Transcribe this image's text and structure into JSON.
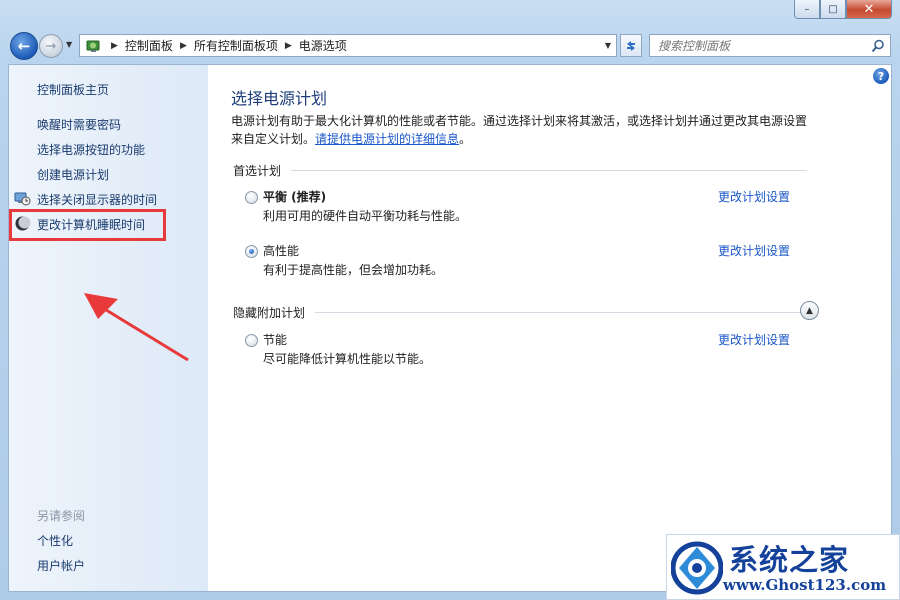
{
  "window": {
    "min_glyph": "–",
    "max_glyph": "□",
    "close_glyph": "✕"
  },
  "navbar": {
    "breadcrumbs": [
      "控制面板",
      "所有控制面板项",
      "电源选项"
    ],
    "search_placeholder": "搜索控制面板"
  },
  "sidebar": {
    "home": "控制面板主页",
    "items": [
      {
        "label": "唤醒时需要密码",
        "icon": ""
      },
      {
        "label": "选择电源按钮的功能",
        "icon": ""
      },
      {
        "label": "创建电源计划",
        "icon": ""
      },
      {
        "label": "选择关闭显示器的时间",
        "icon": "monitor-clock-icon"
      },
      {
        "label": "更改计算机睡眠时间",
        "icon": "moon-icon"
      }
    ],
    "see_also_title": "另请参阅",
    "see_also": [
      "个性化",
      "用户帐户"
    ]
  },
  "main": {
    "title": "选择电源计划",
    "description": "电源计划有助于最大化计算机的性能或者节能。通过选择计划来将其激活，或选择计划并通过更改其电源设置来自定义计划。",
    "details_link": "请提供电源计划的详细信息",
    "preferred_heading": "首选计划",
    "hidden_heading": "隐藏附加计划",
    "plans": [
      {
        "name": "平衡 (推荐)",
        "desc": "利用可用的硬件自动平衡功耗与性能。",
        "selected": false,
        "link": "更改计划设置"
      },
      {
        "name": "高性能",
        "desc": "有利于提高性能，但会增加功耗。",
        "selected": true,
        "link": "更改计划设置"
      },
      {
        "name": "节能",
        "desc": "尽可能降低计算机性能以节能。",
        "selected": false,
        "link": "更改计划设置"
      }
    ],
    "help_glyph": "?"
  },
  "annotation": {
    "highlight_color": "#e83a3a"
  },
  "watermark": {
    "title": "系统之家",
    "url": "www.Ghost123.com"
  }
}
